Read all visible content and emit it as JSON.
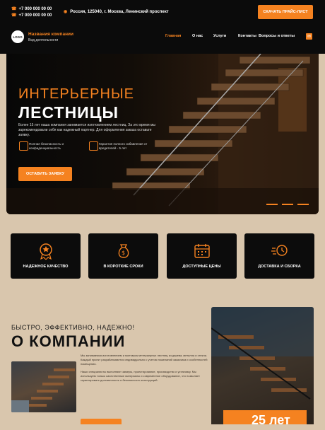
{
  "topbar": {
    "phone1": "+7 000 000 00 00",
    "phone2": "+7 000 000 00 00",
    "address": "Россия, 125040, г. Москва, Ленинский проспект",
    "download_button": "СКАЧАТЬ ПРАЙС-ЛИСТ"
  },
  "header": {
    "logo_text": "LOGO",
    "company_name": "Названия компании",
    "company_activity": "Вид деятельности",
    "nav": [
      "Главная",
      "О нас",
      "Услуги",
      "Контакты",
      "Вопросы и ответы"
    ]
  },
  "hero": {
    "title_line1": "ИНТЕРЬЕРНЫЕ",
    "title_line2": "ЛЕСТНИЦЫ",
    "description": "Более 15 лет наша компания занимается изготовлением лестниц. За это время мы зарекомендовали себя как надежный партнер. Для оформления заказа оставьте заявку.",
    "feature1": "Полная безопасность и конфиденциальность",
    "feature2": "Гарантия полного избавления от вредителей - 5 лет",
    "cta_button": "ОСТАВИТЬ ЗАЯВКУ"
  },
  "advantages": [
    {
      "label": "НАДЕЖНОЕ КАЧЕСТВО",
      "icon": "medal-icon"
    },
    {
      "label": "В КОРОТКИЕ СРОКИ",
      "icon": "money-bag-icon"
    },
    {
      "label": "ДОСТУПНЫЕ ЦЕНЫ",
      "icon": "calendar-icon"
    },
    {
      "label": "ДОСТАВКА И СБОРКА",
      "icon": "delivery-icon"
    }
  ],
  "about": {
    "subtitle": "БЫСТРО, ЭФФЕКТИВНО, НАДЕЖНО!",
    "title": "О КОМПАНИИ",
    "paragraph1": "Мы занимаемся изготовлением и монтажом интерьерных лестниц из дерева, металла и стекла. Каждый проект разрабатывается индивидуально с учетом пожеланий заказчика и особенностей помещения.",
    "paragraph2": "Наши специалисты выполняют замеры, проектирование, производство и установку. Мы используем только качественные материалы и современное оборудование, что позволяет гарантировать долговечность и безопасность конструкций.",
    "badge": "25 лет"
  },
  "colors": {
    "accent": "#f58220",
    "dark": "#0b0b0b",
    "beige": "#d9c6ad"
  }
}
